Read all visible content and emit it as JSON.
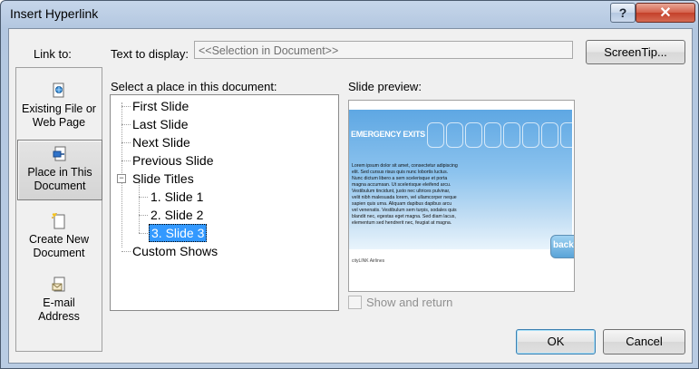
{
  "window": {
    "title": "Insert Hyperlink",
    "help_glyph": "?",
    "close_glyph": "✕"
  },
  "link_to": {
    "label": "Link to:",
    "items": [
      {
        "line1": "Existing File or",
        "line2": "Web Page",
        "icon": "file-web-icon"
      },
      {
        "line1": "Place in This",
        "line2": "Document",
        "icon": "document-place-icon",
        "selected": true
      },
      {
        "line1": "Create New",
        "line2": "Document",
        "icon": "new-document-icon"
      },
      {
        "line1": "E-mail",
        "line2": "Address",
        "icon": "email-icon"
      }
    ]
  },
  "text_to_display": {
    "label": "Text to display:",
    "value": "<<Selection in Document>>"
  },
  "screentip_button": "ScreenTip...",
  "place": {
    "label": "Select a place in this document:",
    "nodes": [
      "First Slide",
      "Last Slide",
      "Next Slide",
      "Previous Slide",
      "Slide Titles",
      "1. Slide 1",
      "2. Slide 2",
      "3. Slide 3",
      "Custom Shows"
    ],
    "selected": "3. Slide 3"
  },
  "preview": {
    "label": "Slide preview:",
    "slide_title": "EMERGENCY EXITS",
    "slide_body": "Lorem ipsum dolor sit amet, consectetur adipiscing elit. Sed cursus risus quis nunc lobortis luctus. Nunc dictum libero a sem scelerisque et porta magna accumsan. Ut scelerisque eleifend arcu. Vestibulum tincidunt, justo nec ultrices pulvinar, velit nibh malesuada lorem, vel ullamcorper neque sapien quis urna. Aliquam dapibus dapibus arcu vel venenatis. Vestibulum sem turpis, sodales quis blandit nec, egestas eget magna. Sed diam lacus, elementum sed hendrerit nec, feugiat at magna.",
    "slide_button": "back",
    "slide_footer": "cityLINK Airlines"
  },
  "show_and_return": {
    "label": "Show and return",
    "checked": false,
    "enabled": false
  },
  "buttons": {
    "ok": "OK",
    "cancel": "Cancel"
  }
}
